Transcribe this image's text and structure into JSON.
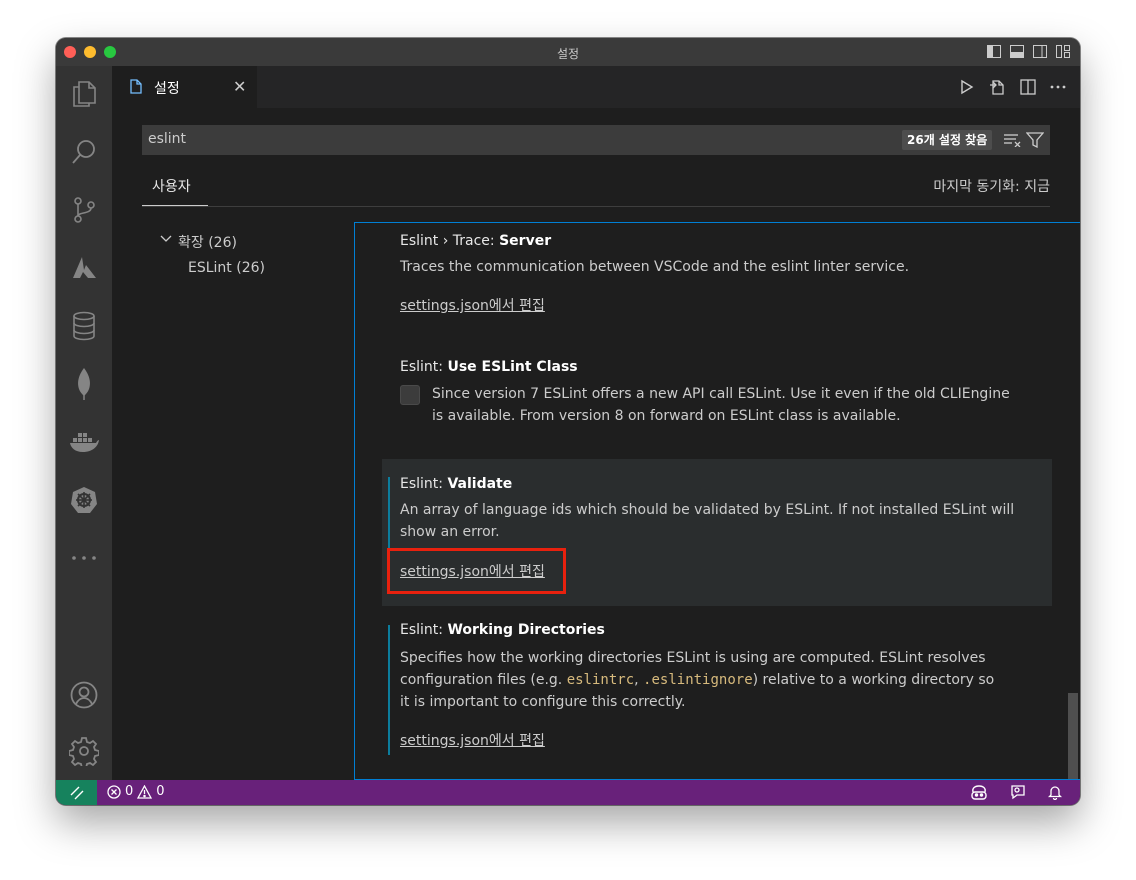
{
  "window": {
    "title": "설정"
  },
  "tab": {
    "label": "설정",
    "close": "✕"
  },
  "search": {
    "value": "eslint",
    "result_count": "26개 설정 찾음"
  },
  "scope": {
    "tab_label": "사용자",
    "sync_status": "마지막 동기화: 지금"
  },
  "toc": [
    {
      "label": "확장 (26)",
      "expanded": true
    },
    {
      "label": "ESLint (26)"
    }
  ],
  "settings": [
    {
      "category": "Eslint › Trace: ",
      "name": "Server",
      "description": "Traces the communication between VSCode and the eslint linter service.",
      "link": "settings.json에서 편집"
    },
    {
      "category": "Eslint: ",
      "name": "Use ESLint Class",
      "description_line1": "Since version 7 ESLint offers a new API call ESLint. Use it even if the old CLIEngine",
      "description_line2": "is available. From version 8 on forward on ESLint class is available.",
      "checked": false
    },
    {
      "category": "Eslint: ",
      "name": "Validate",
      "description_line1": "An array of language ids which should be validated by ESLint. If not installed ESLint will",
      "description_line2": "show an error.",
      "link": "settings.json에서 편집"
    },
    {
      "category": "Eslint: ",
      "name": "Working Directories",
      "description_line1_a": "Specifies how the working directories ESLint is using are computed. ESLint resolves",
      "description_line2_a": "configuration files (e.g. ",
      "code1": "eslintrc",
      "description_line2_b": ", ",
      "code2": ".eslintignore",
      "description_line2_c": ") relative to a working directory so",
      "description_line3": "it is important to configure this correctly.",
      "link": "settings.json에서 편집"
    }
  ],
  "status": {
    "errors": "0",
    "warnings": "0"
  },
  "colors": {
    "status_bar": "#68217a",
    "remote_indicator": "#16825d",
    "focus_border": "#007fd4",
    "highlight": "#e8210e"
  }
}
